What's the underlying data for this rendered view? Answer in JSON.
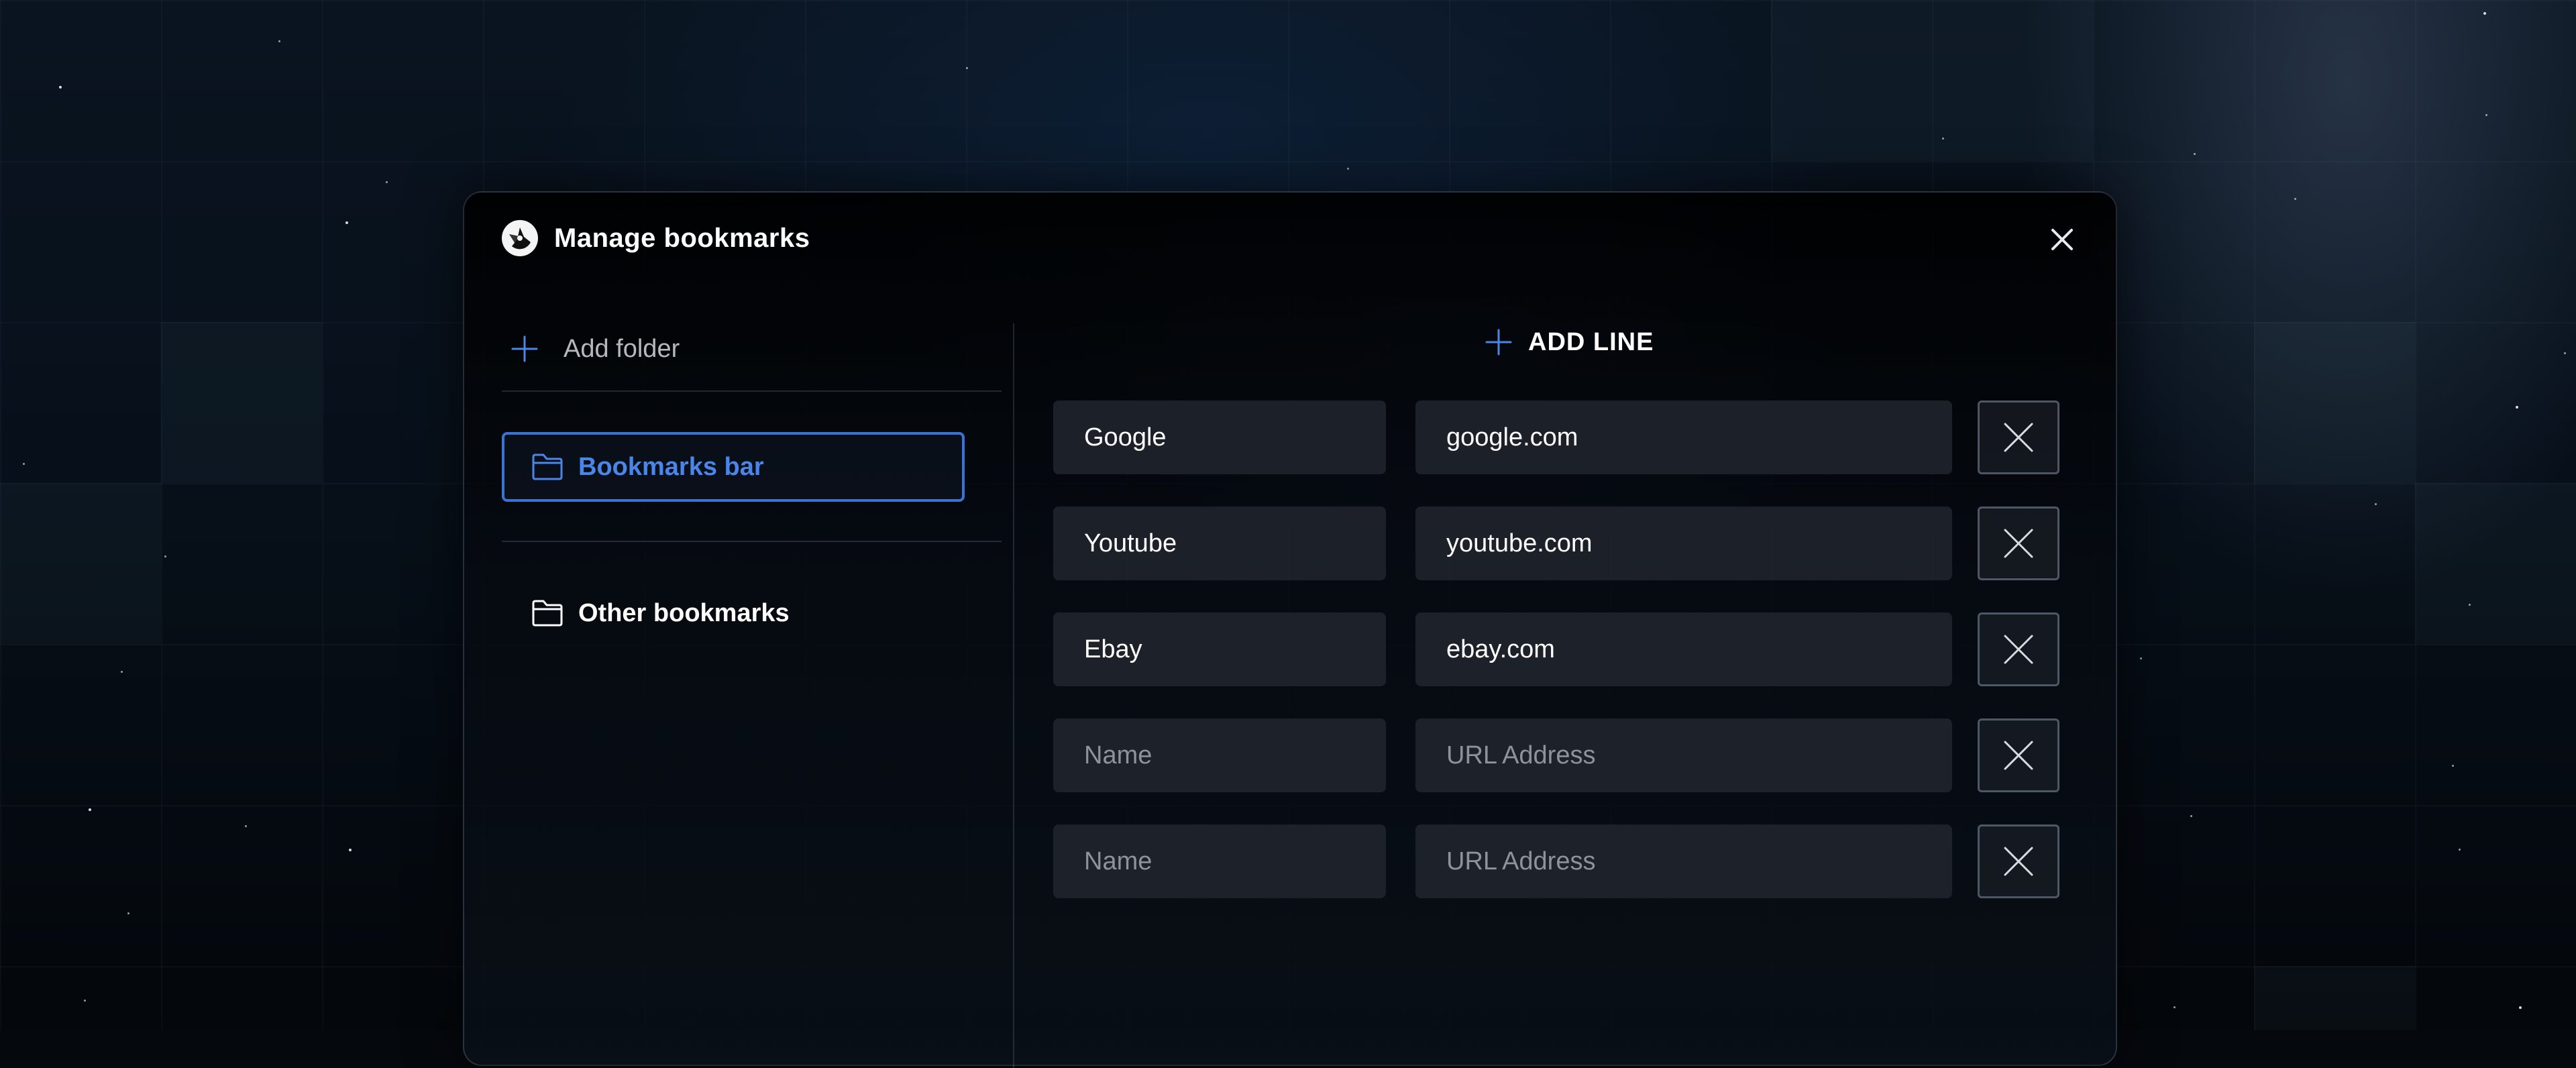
{
  "dialog": {
    "title": "Manage bookmarks",
    "close_icon": "close-icon",
    "logo_icon": "app-logo-icon"
  },
  "sidebar": {
    "add_folder_label": "Add folder",
    "folders": [
      {
        "label": "Bookmarks bar",
        "icon": "folder-icon",
        "active": true
      },
      {
        "label": "Other bookmarks",
        "icon": "folder-icon",
        "active": false
      }
    ]
  },
  "main": {
    "add_line_label": "ADD LINE",
    "rows": [
      {
        "name": "Google",
        "url": "google.com"
      },
      {
        "name": "Youtube",
        "url": "youtube.com"
      },
      {
        "name": "Ebay",
        "url": "ebay.com"
      },
      {
        "name": "",
        "url": ""
      },
      {
        "name": "",
        "url": ""
      }
    ],
    "name_placeholder": "Name",
    "url_placeholder": "URL Address",
    "delete_icon": "x-icon"
  },
  "colors": {
    "accent": "#3b73d2",
    "accent_text": "#4a86e8",
    "text": "#ffffff",
    "muted_text": "#b4b9c0",
    "placeholder": "#8e939b"
  }
}
